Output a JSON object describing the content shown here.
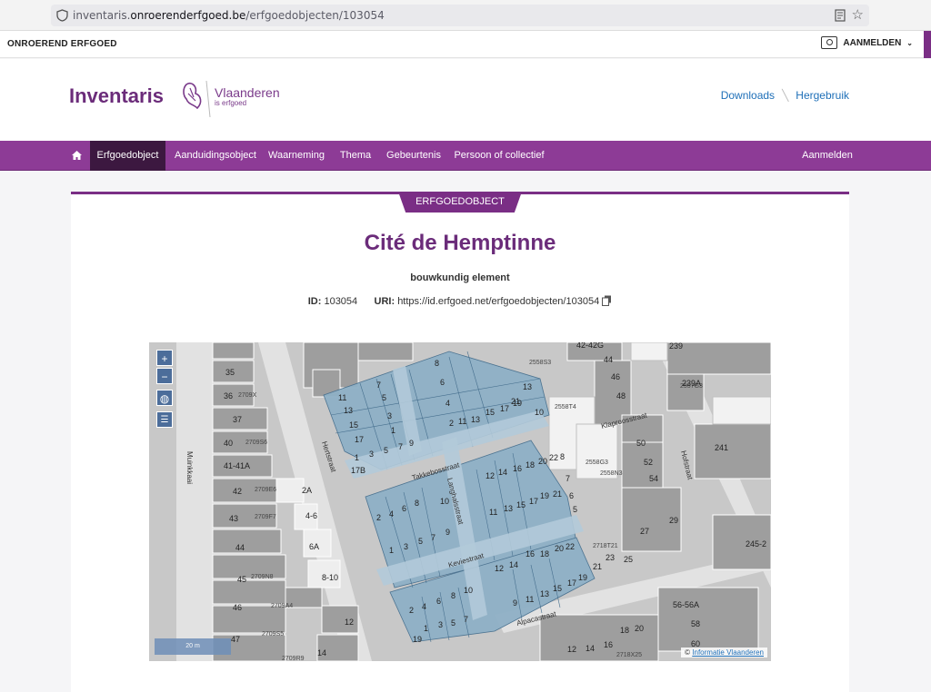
{
  "browser": {
    "url_prefix": "inventaris.",
    "url_domain": "onroerenderfgoed.be",
    "url_path": "/erfgoedobjecten/103054"
  },
  "ribbon": {
    "brand": "ONROEREND ERFGOED",
    "login": "AANMELDEN"
  },
  "header": {
    "logo": "Inventaris",
    "vlaanderen": "Vlaanderen",
    "vlaanderen_sub": "is erfgoed",
    "links": [
      "Downloads",
      "Hergebruik"
    ]
  },
  "nav": {
    "items": [
      "Erfgoedobject",
      "Aanduidingsobject",
      "Waarneming",
      "Thema",
      "Gebeurtenis",
      "Persoon of collectief"
    ],
    "login": "Aanmelden",
    "active": "Erfgoedobject"
  },
  "object": {
    "tag": "ERFGOEDOBJECT",
    "title": "Cité de Hemptinne",
    "type": "bouwkundig element",
    "id_label": "ID:",
    "id_value": "103054",
    "uri_label": "URI:",
    "uri_value": "https://id.erfgoed.net/erfgoedobjecten/103054"
  },
  "map": {
    "zoom_in": "+",
    "zoom_out": "−",
    "scale": "20 m",
    "attribution_prefix": "©",
    "attribution_link": "Informatie Vlaanderen",
    "streets": [
      "Muinkkaai",
      "Hertstraat",
      "Takkebosstraat",
      "Langhalsstraat",
      "Keviestraat",
      "Alpacastraat",
      "Klaproosstraat",
      "Hofstraat"
    ],
    "parcel_labels": {
      "left_col": [
        "35",
        "36",
        "37",
        "40",
        "41-41A",
        "42",
        "43",
        "44",
        "45",
        "46",
        "47"
      ],
      "left_codes": [
        "2709X",
        "2709S6",
        "2709E6",
        "2709F7",
        "2709N8",
        "2709A4",
        "2709S5",
        "2709R9"
      ],
      "left_mid": [
        "2A",
        "4-6",
        "6A",
        "8-10",
        "12",
        "14"
      ],
      "right": [
        "239",
        "239A",
        "2557G3",
        "241",
        "245-2",
        "56-56A",
        "58",
        "60",
        "42-42G",
        "44",
        "46",
        "48",
        "50",
        "52",
        "54",
        "27",
        "29",
        "23",
        "25",
        "20",
        "18",
        "16",
        "14"
      ],
      "right_codes": [
        "2558S3",
        "2558T4",
        "2558G3",
        "2558N3",
        "2718T21",
        "2718X25"
      ],
      "block": [
        "8",
        "6",
        "4",
        "2",
        "7",
        "5",
        "3",
        "1",
        "11",
        "13",
        "15",
        "17",
        "9",
        "10",
        "12",
        "14",
        "16",
        "18",
        "19",
        "20",
        "21",
        "22",
        "17B"
      ]
    }
  }
}
